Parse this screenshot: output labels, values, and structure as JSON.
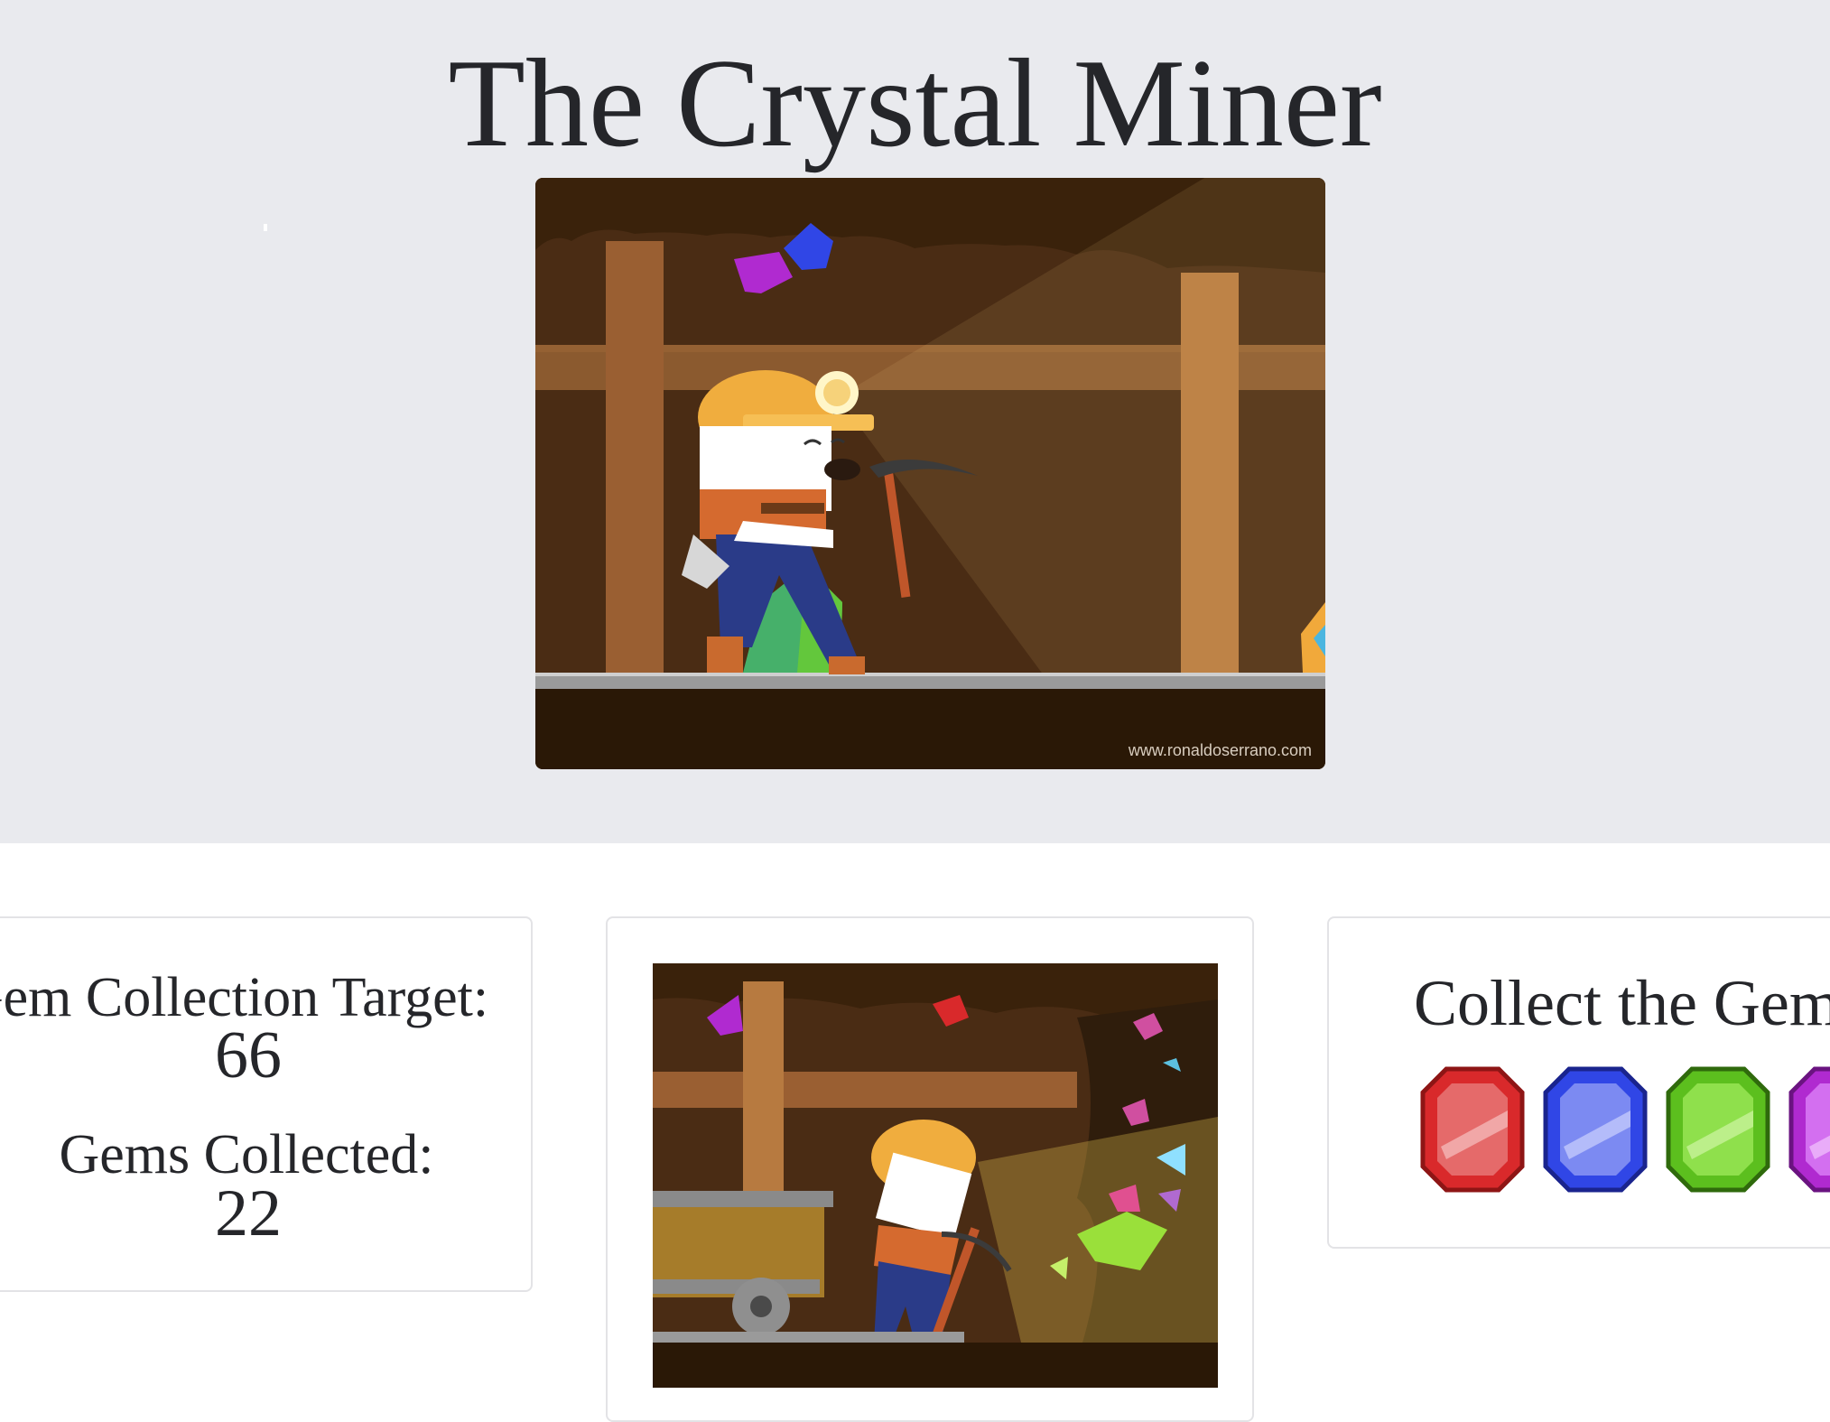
{
  "page": {
    "title": "The Crystal Miner"
  },
  "hero": {
    "image_alt": "Cartoon miner walking through a mine tunnel with a pickaxe",
    "watermark": "www.ronaldoserrano.com"
  },
  "stats": {
    "target_label": "Gem Collection Target:",
    "target_value": "66",
    "collected_label": "Gems Collected:",
    "collected_value": "22"
  },
  "scene": {
    "image_alt": "Miner digging gems next to a mine cart"
  },
  "collect": {
    "heading": "Collect the Gems",
    "gems": [
      {
        "name": "red",
        "color": "#d9292b",
        "icon": "red-gem-icon"
      },
      {
        "name": "blue",
        "color": "#3046e6",
        "icon": "blue-gem-icon"
      },
      {
        "name": "green",
        "color": "#5cbf1e",
        "icon": "green-gem-icon"
      },
      {
        "name": "purple",
        "color": "#b02ad0",
        "icon": "purple-gem-icon"
      }
    ]
  },
  "colors": {
    "hero_background": "#e9eaee",
    "mine_dark": "#3a220b",
    "mine_wall": "#4a2c14",
    "beam": "#a8683a"
  }
}
